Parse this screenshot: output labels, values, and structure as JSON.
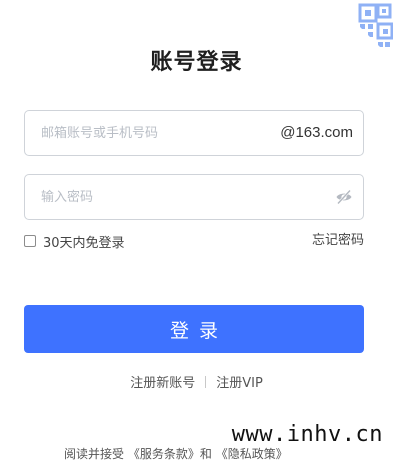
{
  "header": {
    "title": "账号登录"
  },
  "login_form": {
    "email_placeholder": "邮箱账号或手机号码",
    "email_value": "",
    "email_domain_suffix": "@163.com",
    "password_placeholder": "输入密码",
    "password_value": "",
    "password_visibility_icon": "eye-off-icon",
    "remember_label": "30天内免登录",
    "remember_checked": false,
    "forgot_label": "忘记密码",
    "submit_label": "登录"
  },
  "links": {
    "register_new": "注册新账号",
    "register_vip": "注册VIP"
  },
  "agreement": {
    "prefix": "阅读并接受",
    "terms": "《服务条款》",
    "and": "和",
    "privacy": "《隐私政策》"
  },
  "watermark": "www.inhv.cn",
  "corner": {
    "icon": "qrcode-icon"
  },
  "colors": {
    "accent": "#3e72ff",
    "qr_tint": "#8fb1f5"
  }
}
